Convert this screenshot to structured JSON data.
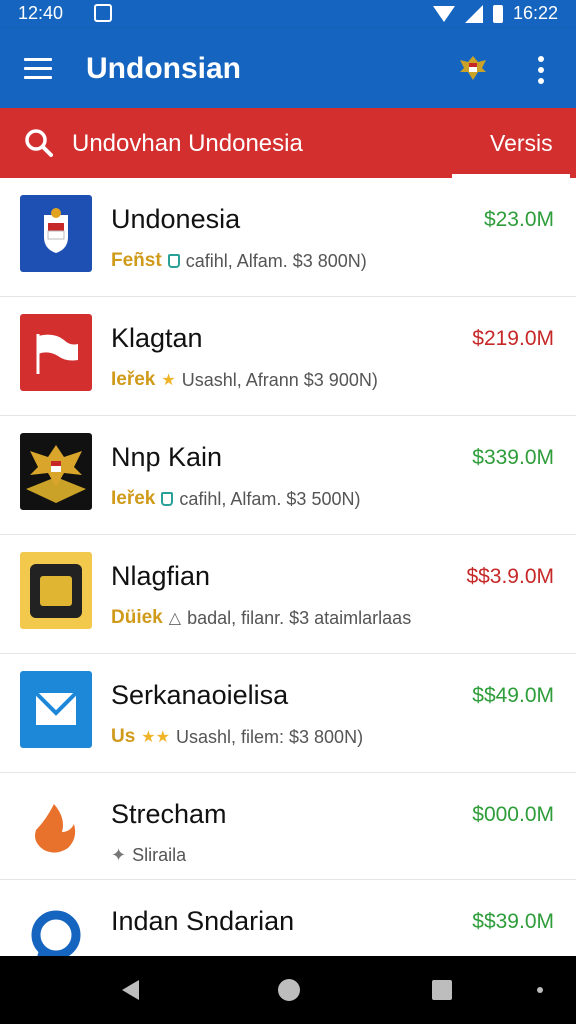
{
  "status_bar": {
    "time": "12:40",
    "right_time": "16:22"
  },
  "app_bar": {
    "title": "Undonsian"
  },
  "search": {
    "query": "Undovhan Undonesia",
    "tab_label": "Versis"
  },
  "apps": [
    {
      "name": "Undonesia",
      "price": "$23.0M",
      "price_color": "#2e9d3a",
      "badge": "Feñst",
      "details": "cafihl, Alfam. $3 800N)"
    },
    {
      "name": "Klagtan",
      "price": "$219.0M",
      "price_color": "#c62828",
      "badge": "Ieřek",
      "details": "Usashl, Afrann $3 900N)"
    },
    {
      "name": "Nnp Kain",
      "price": "$339.0M",
      "price_color": "#2e9d3a",
      "badge": "Ieřek",
      "details": "cafihl, Alfam. $3 500N)"
    },
    {
      "name": "Nlagfian",
      "price": "$$3.9.0M",
      "price_color": "#c62828",
      "badge": "Düiek",
      "details": "badal, filanr. $3 ataimlarlaas"
    },
    {
      "name": "Serkanaoielisa",
      "price": "$$49.0M",
      "price_color": "#2e9d3a",
      "badge": "Us",
      "details": "Usashl, filem: $3 800N)"
    },
    {
      "name": "Strecham",
      "price": "$000.0M",
      "price_color": "#2e9d3a",
      "badge": "",
      "details": "Sliraila"
    },
    {
      "name": "Indan Sndarian",
      "price": "$$39.0M",
      "price_color": "#2e9d3a",
      "badge": "",
      "details": ""
    }
  ],
  "icons": {
    "menu": "hamburger-menu-icon",
    "emblem": "garuda-emblem-icon",
    "more": "overflow-menu-icon",
    "search": "search-icon"
  }
}
